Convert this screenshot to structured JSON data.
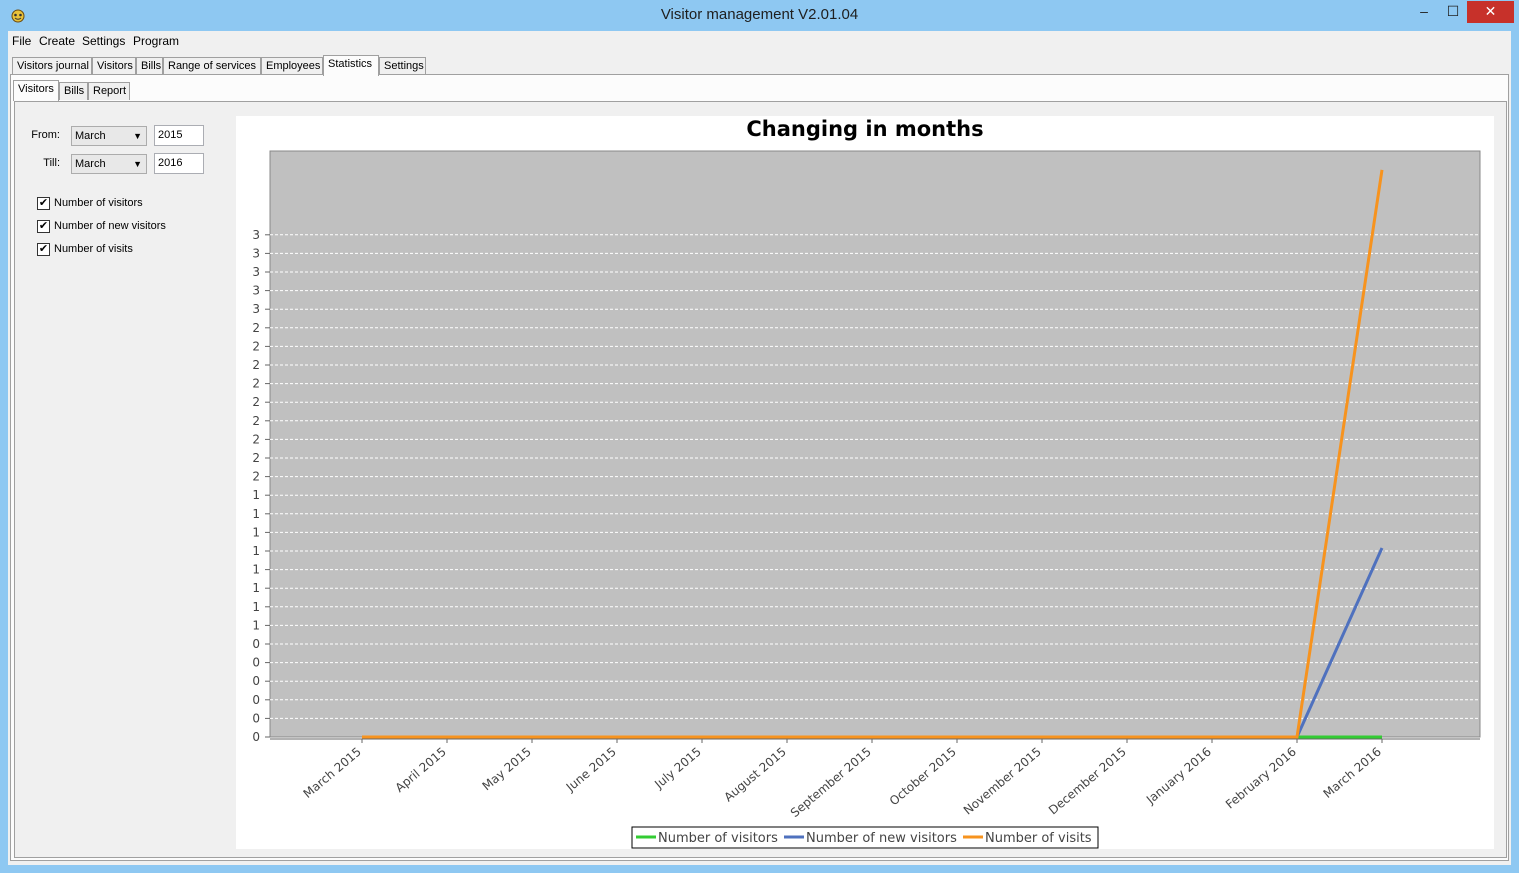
{
  "window": {
    "title": "Visitor management V2.01.04",
    "controls": {
      "minimize": "–",
      "maximize": "☐",
      "close": "✕"
    }
  },
  "menu": [
    "File",
    "Create",
    "Settings",
    "Program"
  ],
  "main_tabs": [
    {
      "label": "Visitors journal",
      "active": false
    },
    {
      "label": "Visitors",
      "active": false
    },
    {
      "label": "Bills",
      "active": false
    },
    {
      "label": "Range of services",
      "active": false
    },
    {
      "label": "Employees",
      "active": false
    },
    {
      "label": "Statistics",
      "active": true
    },
    {
      "label": "Settings",
      "active": false
    }
  ],
  "sub_tabs": [
    {
      "label": "Visitors",
      "active": true
    },
    {
      "label": "Bills",
      "active": false
    },
    {
      "label": "Report",
      "active": false
    }
  ],
  "filters": {
    "from_label": "From:",
    "from_month": "March",
    "from_year": "2015",
    "till_label": "Till:",
    "till_month": "March",
    "till_year": "2016"
  },
  "checkboxes": [
    {
      "label": "Number of visitors",
      "checked": true
    },
    {
      "label": "Number of new visitors",
      "checked": true
    },
    {
      "label": "Number of visits",
      "checked": true
    }
  ],
  "colors": {
    "plot_bg": "#c0c0c0",
    "series_visitors": "#33cc33",
    "series_new_visitors": "#4f71be",
    "series_visits": "#f7931e"
  },
  "chart_data": {
    "type": "line",
    "title": "Changing in months",
    "categories": [
      "March 2015",
      "April 2015",
      "May 2015",
      "June 2015",
      "July 2015",
      "August 2015",
      "September 2015",
      "October 2015",
      "November 2015",
      "December 2015",
      "January 2016",
      "February 2016",
      "March 2016"
    ],
    "y_tick_labels": [
      "0",
      "0",
      "0",
      "0",
      "0",
      "0",
      "1",
      "1",
      "1",
      "1",
      "1",
      "1",
      "1",
      "1",
      "2",
      "2",
      "2",
      "2",
      "2",
      "2",
      "2",
      "2",
      "2",
      "3",
      "3",
      "3",
      "3",
      "3"
    ],
    "ylim": [
      0,
      3.1
    ],
    "grid": true,
    "legend_position": "bottom",
    "series": [
      {
        "name": "Number of visitors",
        "color": "#33cc33",
        "values": [
          0,
          0,
          0,
          0,
          0,
          0,
          0,
          0,
          0,
          0,
          0,
          0,
          0
        ]
      },
      {
        "name": "Number of new visitors",
        "color": "#4f71be",
        "values": [
          0,
          0,
          0,
          0,
          0,
          0,
          0,
          0,
          0,
          0,
          0,
          0,
          1
        ]
      },
      {
        "name": "Number of visits",
        "color": "#f7931e",
        "values": [
          0,
          0,
          0,
          0,
          0,
          0,
          0,
          0,
          0,
          0,
          0,
          0,
          3
        ]
      }
    ]
  }
}
